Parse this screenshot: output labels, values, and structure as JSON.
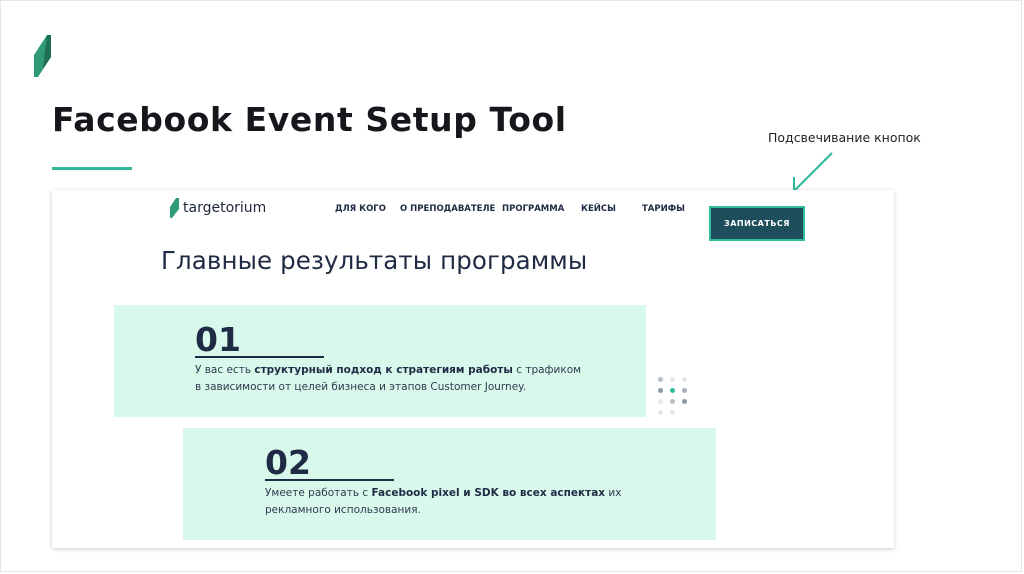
{
  "slide": {
    "title": "Facebook Event Setup Tool",
    "annotation": "Подсвечивание кнопок"
  },
  "colors": {
    "accent": "#2fb99a",
    "navy": "#1f2a44",
    "card_bg": "#d8f8ec",
    "button_bg": "#1e4d5c",
    "button_border": "#2fbf9c"
  },
  "site": {
    "logo_text": "targetorium",
    "nav": [
      "ДЛЯ КОГО",
      "О ПРЕПОДАВАТЕЛЕ",
      "ПРОГРАММА",
      "КЕЙСЫ",
      "ТАРИФЫ"
    ],
    "signup_label": "ЗАПИСАТЬСЯ",
    "section_title": "Главные результаты программы",
    "cards": [
      {
        "number": "01",
        "line1_pre": "У вас есть ",
        "line1_bold": "структурный подход к стратегиям работы",
        "line1_post": " с трафиком",
        "line2": "в зависимости от целей бизнеса и этапов Customer Journey."
      },
      {
        "number": "02",
        "line1_pre": "Умеете работать с ",
        "line1_bold": "Facebook pixel и SDK во всех аспектах",
        "line1_post": " их",
        "line2": "рекламного использования."
      }
    ]
  },
  "icons": {
    "slide_logo": "logo-mark-icon",
    "site_logo": "targetorium-logo-icon",
    "annotation_arrow": "arrow-down-left-icon",
    "decoration": "dot-grid-icon"
  }
}
